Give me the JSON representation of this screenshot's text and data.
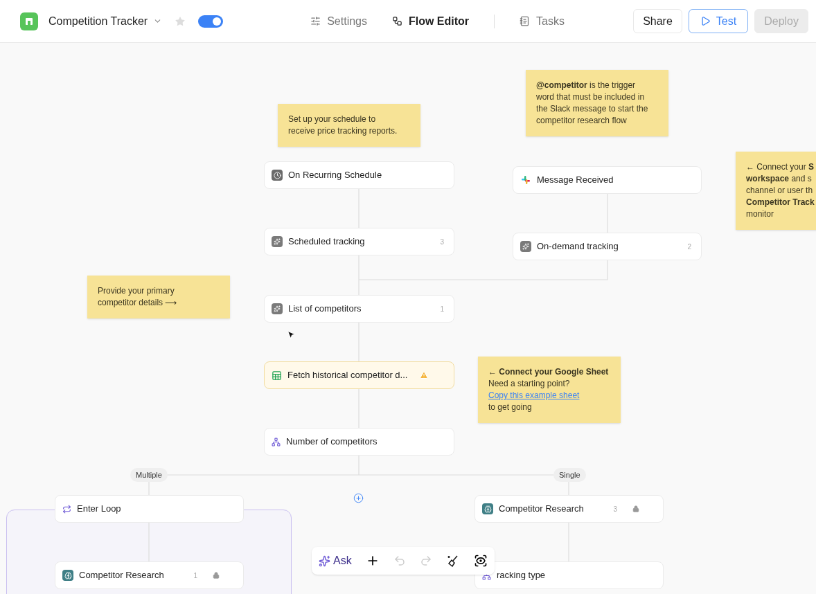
{
  "header": {
    "title": "Competition Tracker",
    "starred": false,
    "toggle": {
      "on": true
    },
    "tabs": [
      {
        "label": "Settings",
        "selected": false
      },
      {
        "label": "Flow Editor",
        "selected": true
      },
      {
        "label": "Tasks",
        "selected": false
      }
    ],
    "buttons": [
      {
        "label": "Share",
        "kind": "plain",
        "disabled": false
      },
      {
        "label": "Test",
        "kind": "test",
        "disabled": false
      },
      {
        "label": "Deploy",
        "kind": "plain",
        "disabled": true
      }
    ]
  },
  "notes": [
    {
      "lines": [
        "Set up your schedule to",
        "receive price tracking reports."
      ]
    },
    {
      "lines": [
        "**@competitor** is the trigger",
        "word that must be included in",
        "the Slack message to start the",
        "competitor research flow"
      ]
    },
    {
      "lines": [
        "← Connect your **S**",
        "**workspace** and s",
        "channel or user th",
        "**Competitor Track**",
        "monitor"
      ]
    },
    {
      "lines": [
        "Provide your primary",
        "competitor details ⟶"
      ]
    },
    {
      "lines": [
        "**← Connect your Google Sheet**",
        "Need a starting point?"
      ],
      "link": "Copy this example sheet",
      "after": "to get going"
    }
  ],
  "nodes": [
    {
      "label": "On Recurring Schedule",
      "kind": "schedule",
      "locked": false,
      "warning": false
    },
    {
      "label": "Scheduled tracking",
      "kind": "ai",
      "count": "3",
      "locked": false,
      "warning": false
    },
    {
      "label": "Message Received",
      "kind": "slack",
      "locked": false,
      "warning": false
    },
    {
      "label": "On-demand tracking",
      "kind": "ai",
      "count": "2",
      "locked": false,
      "warning": false
    },
    {
      "label": "List of competitors",
      "kind": "ai",
      "count": "1",
      "locked": false,
      "warning": false
    },
    {
      "label": "Fetch historical competitor d...",
      "kind": "sheet",
      "locked": false,
      "warning": true
    },
    {
      "label": "Number of competitors",
      "kind": "branch",
      "locked": false,
      "warning": false
    },
    {
      "label": "Enter Loop",
      "kind": "loop",
      "locked": false,
      "warning": false
    },
    {
      "label": "Competitor Research",
      "kind": "research",
      "count": "3",
      "locked": true,
      "warning": false
    },
    {
      "label": "Competitor Research",
      "kind": "research",
      "count": "1",
      "locked": true,
      "warning": false
    },
    {
      "label": "racking type",
      "kind": "tracking",
      "locked": false,
      "warning": false
    }
  ],
  "branches": [
    "Multiple",
    "Single"
  ],
  "toolbar": {
    "ask": "Ask",
    "undo_disabled": true,
    "redo_disabled": true
  }
}
